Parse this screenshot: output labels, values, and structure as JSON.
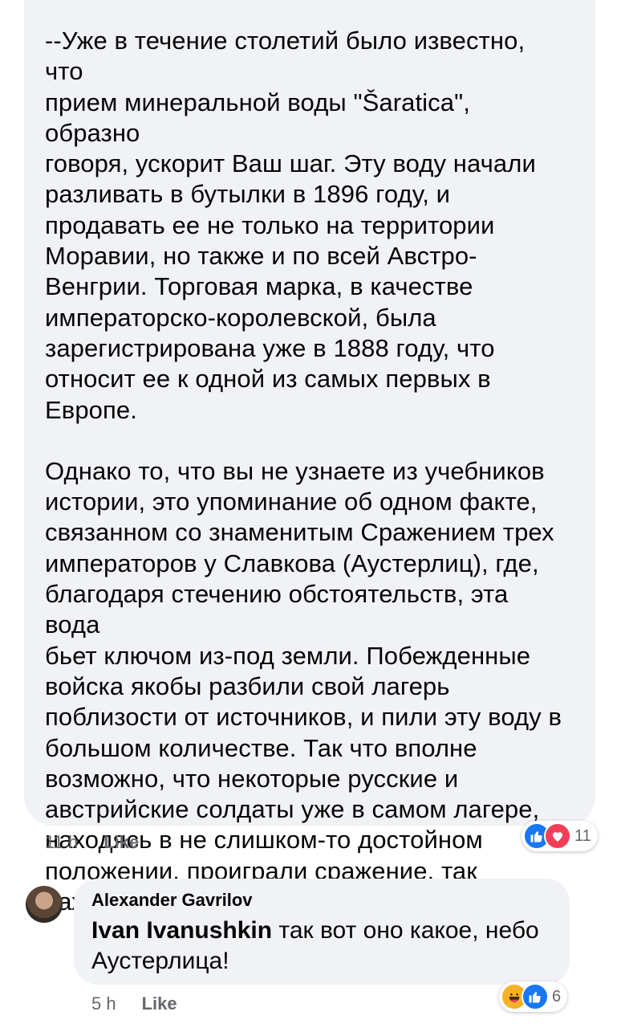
{
  "comment1": {
    "paragraph1": "--Уже в течение столетий было известно, что\nприем минеральной воды \"Šaratica\", образно\nговоря, ускорит Ваш шаг. Эту воду начали\nразливать в бутылки в 1896 году, и\nпродавать ее не только на территории\nМоравии, но также и по всей Австро-\nВенгрии. Торговая марка, в качестве\nимператорско-королевской, была\nзарегистрирована уже в 1888 году, что\nотносит ее к одной из самых первых в\nЕвропе.",
    "paragraph2": "Однако то, что вы не узнаете из учебников\nистории, это упоминание об одном факте,\nсвязанном со знаменитым Сражением трех\nимператоров у Славкова (Аустерлиц), где,\nблагодаря стечению обстоятельств, эта вода\nбьет ключом из-под земли. Побежденные\nвойска якобы разбили свой лагерь\nпоблизости от источников, и пили эту воду в\nбольшом количестве. Так что вполне\nвозможно, что некоторые русские и\nавстрийские солдаты уже в самом лагере,\nнаходясь в не слишком-то достойном\nположении, проиграли сражение, так\nважное для Европы...--",
    "time": "11 h",
    "like_label": "Like",
    "reaction_icons": [
      "like-icon",
      "love-icon"
    ],
    "reaction_count": "11"
  },
  "comment2": {
    "author": "Alexander Gavrilov",
    "mention": "Ivan Ivanushkin",
    "text": " так вот оно какое, небо\nАустерлица!",
    "time": "5 h",
    "like_label": "Like",
    "reaction_icons": [
      "haha-icon",
      "like-icon"
    ],
    "reaction_count": "6"
  },
  "colors": {
    "bubble": "#f0f2f5",
    "meta_text": "#65676b",
    "like_blue": "#1877f2",
    "love_red": "#f33e58",
    "haha_yellow": "#f7b125"
  }
}
